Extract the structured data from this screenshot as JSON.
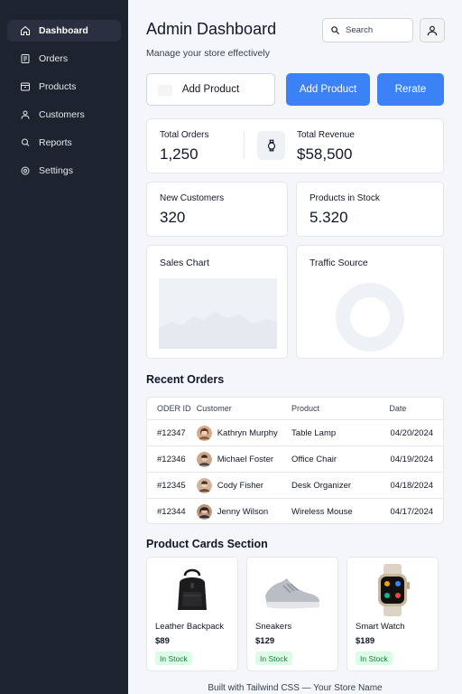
{
  "sidebar": {
    "items": [
      {
        "label": "Dashboard",
        "icon": "home-icon",
        "active": true
      },
      {
        "label": "Orders",
        "icon": "receipt-icon",
        "active": false
      },
      {
        "label": "Products",
        "icon": "box-icon",
        "active": false
      },
      {
        "label": "Customers",
        "icon": "user-icon",
        "active": false
      },
      {
        "label": "Reports",
        "icon": "magnifier-icon",
        "active": false
      },
      {
        "label": "Settings",
        "icon": "gear-icon",
        "active": false
      }
    ]
  },
  "header": {
    "title": "Admin Dashboard",
    "subtitle": "Manage your store effectively",
    "search_placeholder": "Search"
  },
  "actions": {
    "add_product_outline": "Add Product",
    "add_product_primary": "Add Product",
    "rerate": "Rerate"
  },
  "stats": {
    "total_orders": {
      "label": "Total Orders",
      "value": "1,250"
    },
    "total_revenue": {
      "label": "Total Revenue",
      "value": "$58,500"
    },
    "new_customers": {
      "label": "New Customers",
      "value": "320"
    },
    "products_in_stock": {
      "label": "Products in Stock",
      "value": "5.320"
    }
  },
  "charts": {
    "sales_title": "Sales Chart",
    "traffic_title": "Traffic Source"
  },
  "recent_orders": {
    "title": "Recent Orders",
    "columns": [
      "ODER ID",
      "Customer",
      "Product",
      "Date"
    ],
    "rows": [
      {
        "id": "#12347",
        "customer": "Kathryn Murphy",
        "product": "Table Lamp",
        "date": "04/20/2024"
      },
      {
        "id": "#12346",
        "customer": "Michael Foster",
        "product": "Office Chair",
        "date": "04/19/2024"
      },
      {
        "id": "#12345",
        "customer": "Cody Fisher",
        "product": "Desk Organizer",
        "date": "04/18/2024"
      },
      {
        "id": "#12344",
        "customer": "Jenny Wilson",
        "product": "Wireless Mouse",
        "date": "04/17/2024"
      }
    ]
  },
  "product_cards": {
    "title": "Product Cards Section",
    "items": [
      {
        "name": "Leather Backpack",
        "price": "$89",
        "badge": "In Stock",
        "icon": "backpack-icon"
      },
      {
        "name": "Sneakers",
        "price": "$129",
        "badge": "In Stock",
        "icon": "sneaker-icon"
      },
      {
        "name": "Smart Watch",
        "price": "$189",
        "badge": "In Stock",
        "icon": "watch-icon"
      }
    ]
  },
  "footer": {
    "text": "Built with Tailwind CSS — Your Store Name"
  },
  "colors": {
    "sidebar_bg": "#1e2330",
    "accent": "#3b82f6",
    "badge_bg": "#dcfce7",
    "badge_text": "#15803d"
  }
}
